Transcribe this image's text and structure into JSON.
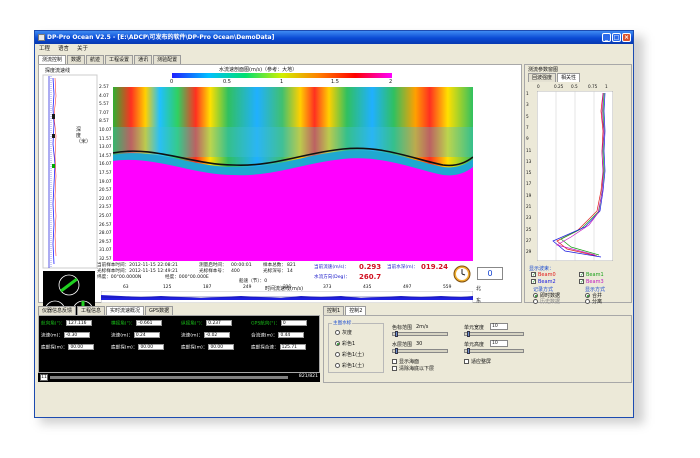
{
  "window": {
    "title": "DP-Pro Ocean V2.5 - [E:\\ADCP\\可发布的软件\\DP-Pro Ocean\\DemoData]",
    "buttons": [
      "_",
      "□",
      "×"
    ]
  },
  "menu": [
    "工程",
    "语言",
    "关于"
  ],
  "tabs": [
    "测流控制",
    "数据",
    "航迹",
    "工程设置",
    "通讯",
    "测验配置"
  ],
  "depth_profile": {
    "title": "探度流速线",
    "axis_label": "深度（米）"
  },
  "heatmap": {
    "title": "水流速剖面图(m/s)（参考：大地）",
    "colorbar_ticks": [
      "0",
      "0.5",
      "1",
      "1.5",
      "2"
    ],
    "colors": {
      "low": "#ff00ff",
      "mid": "#00dd55",
      "high": "#ff2200",
      "track": "#111111"
    },
    "depth_ticks": [
      "2.57",
      "4.07",
      "5.57",
      "7.07",
      "8.57",
      "10.07",
      "11.57",
      "13.07",
      "14.57",
      "16.07",
      "17.57",
      "19.07",
      "20.57",
      "22.07",
      "23.57",
      "25.07",
      "26.57",
      "28.07",
      "29.57",
      "31.07",
      "32.57"
    ]
  },
  "info": {
    "current_time": "当前样本时间：2012-11-15 22:08:21",
    "ensemble_label": "测量启时间：",
    "ensemble_value": "00:00:01",
    "sample_total_label": "样本总数：",
    "sample_total_value": "821",
    "first_time": "光标样本时间：2012-11-15 12:49:21",
    "cursor_no_label": "光标样本号：",
    "cursor_no_value": "400",
    "cursor_vel_label": "光标深号：",
    "cursor_vel_value": "14",
    "lat": "纬度：00°00.0000N",
    "lon": "经度：000°00.000E",
    "heading": "船速（节）：0",
    "avg_vel_label": "当前流速(m/s)：",
    "avg_vel_value": "0.293",
    "water_level_label": "当前水深(m)：",
    "water_level_value": "019.24",
    "direction_label": "水流方向(Deg)：",
    "direction_value": "260.7",
    "counter": "0"
  },
  "timeseries": {
    "title": "时间流速线(m/s)",
    "ticks": [
      "63",
      "125",
      "187",
      "249",
      "311",
      "373",
      "435",
      "497",
      "559"
    ],
    "north": "北",
    "east": "东"
  },
  "right_panel": {
    "title": "测流参数窗图",
    "tabs": [
      "回波强度",
      "相关性"
    ],
    "x_ticks": [
      "0",
      "0.25",
      "0.5",
      "0.75",
      "1"
    ],
    "y_ticks": [
      "1",
      "3",
      "5",
      "7",
      "9",
      "11",
      "13",
      "15",
      "17",
      "19",
      "21",
      "23",
      "25",
      "27",
      "29"
    ],
    "display_title": "显示波束：",
    "beams": [
      "Beam0",
      "Beam1",
      "Beam2",
      "Beam3"
    ],
    "beam_colors": [
      "#e01818",
      "#18a018",
      "#1818e0",
      "#c018c0"
    ],
    "record_title": "记录方式",
    "record_options": [
      "即时数据",
      "历史数据"
    ],
    "display_mode_title": "显示方式",
    "display_mode_options": [
      "合并",
      "分离"
    ]
  },
  "bottom_tabs": [
    "仪器信息反馈",
    "工程信息",
    "实时流速概况",
    "GPS数据"
  ],
  "grid": {
    "rows": [
      [
        "航向角(°)：",
        "127.116",
        "横摇角(°)：",
        "-0.661",
        "纵摇角(°)：",
        "0.237",
        "GPS航向(°)：",
        "0"
      ],
      [
        "流速(m)：",
        "-0.30",
        "流速(m)：",
        "0.24",
        "流速(m)：",
        "-0.02",
        "合流速(m)：",
        "0.44"
      ],
      [
        "底部探(m)：",
        "00.00",
        "底部探(m)：",
        "00.00",
        "底部探(m)：",
        "00.00",
        "底部探合速：",
        "125.71"
      ]
    ],
    "progress": "821/821",
    "progress_start": "11"
  },
  "control": {
    "tabs": [
      "控制1",
      "控制2"
    ],
    "group_title": "主图水标",
    "options": [
      "灰度",
      "彩色1",
      "彩色1(土)",
      "彩色1(土)"
    ],
    "color_range_label": "色标范围",
    "color_range_unit": "2m/s",
    "unit_width_label": "单元宽度",
    "unit_width_value": "10",
    "depth_range_label": "水层范围",
    "depth_range_value": "30",
    "unit_height_label": "单元高度",
    "unit_height_value": "10",
    "checks": [
      "显示海面",
      "清除海底以下层",
      "适应整屏"
    ]
  }
}
